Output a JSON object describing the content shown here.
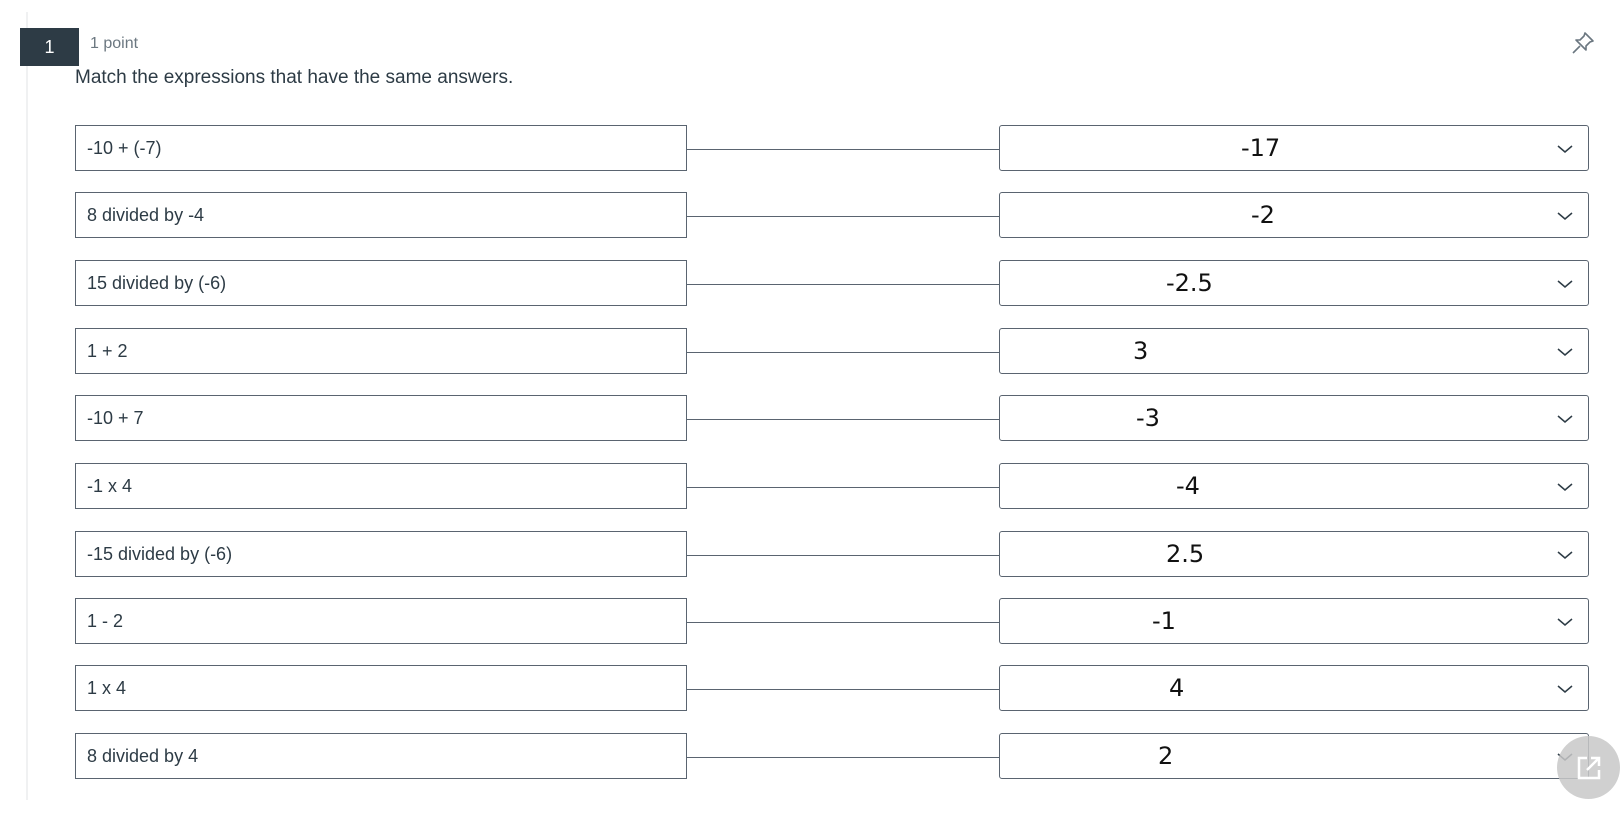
{
  "question": {
    "number": "1",
    "points": "1 point",
    "prompt": "Match the expressions that have the same answers."
  },
  "icons": {
    "pin": "pin-icon",
    "chevron": "chevron-down-icon",
    "popout": "external-link-icon"
  },
  "rows": [
    {
      "expression": "-10 + (-7)",
      "answer": "-17"
    },
    {
      "expression": "8 divided by -4",
      "answer": "-2"
    },
    {
      "expression": "15 divided by (-6)",
      "answer": "-2.5"
    },
    {
      "expression": "1 + 2",
      "answer": "3"
    },
    {
      "expression": "-10 + 7",
      "answer": "-3"
    },
    {
      "expression": "-1 x 4",
      "answer": "-4"
    },
    {
      "expression": "-15 divided by (-6)",
      "answer": "2.5"
    },
    {
      "expression": "1 - 2",
      "answer": "-1"
    },
    {
      "expression": "1 x 4",
      "answer": "4"
    },
    {
      "expression": "8 divided by 4",
      "answer": "2"
    }
  ]
}
